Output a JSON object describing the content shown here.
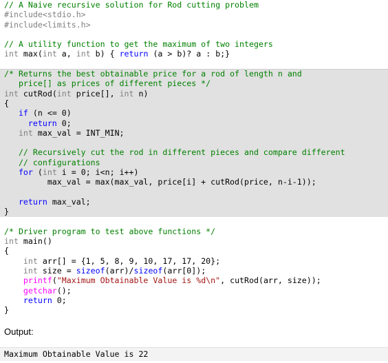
{
  "code": [
    {
      "hl": false,
      "tokens": [
        {
          "t": "// A Naive recursive solution for Rod cutting problem",
          "c": "comment"
        }
      ]
    },
    {
      "hl": false,
      "tokens": [
        {
          "t": "#include<stdio.h>",
          "c": "pre"
        }
      ]
    },
    {
      "hl": false,
      "tokens": [
        {
          "t": "#include<limits.h>",
          "c": "pre"
        }
      ]
    },
    {
      "hl": false,
      "tokens": [
        {
          "t": "",
          "c": "plain"
        }
      ]
    },
    {
      "hl": false,
      "tokens": [
        {
          "t": "// A utility function to get the maximum of two integers",
          "c": "comment"
        }
      ]
    },
    {
      "hl": false,
      "tokens": [
        {
          "t": "int",
          "c": "type"
        },
        {
          "t": " max(",
          "c": "plain"
        },
        {
          "t": "int",
          "c": "type"
        },
        {
          "t": " a, ",
          "c": "plain"
        },
        {
          "t": "int",
          "c": "type"
        },
        {
          "t": " b) { ",
          "c": "plain"
        },
        {
          "t": "return",
          "c": "kw"
        },
        {
          "t": " (a > b)? a : b;}",
          "c": "plain"
        }
      ]
    },
    {
      "hl": false,
      "tokens": [
        {
          "t": "",
          "c": "plain"
        }
      ]
    },
    {
      "hl": true,
      "first": true,
      "tokens": [
        {
          "t": "/* Returns the best obtainable price for a rod of length n and",
          "c": "comment"
        }
      ]
    },
    {
      "hl": true,
      "tokens": [
        {
          "t": "   price[] as prices of different pieces */",
          "c": "comment"
        }
      ]
    },
    {
      "hl": true,
      "tokens": [
        {
          "t": "int",
          "c": "type"
        },
        {
          "t": " cutRod(",
          "c": "plain"
        },
        {
          "t": "int",
          "c": "type"
        },
        {
          "t": " price[], ",
          "c": "plain"
        },
        {
          "t": "int",
          "c": "type"
        },
        {
          "t": " n)",
          "c": "plain"
        }
      ]
    },
    {
      "hl": true,
      "tokens": [
        {
          "t": "{",
          "c": "plain"
        }
      ]
    },
    {
      "hl": true,
      "tokens": [
        {
          "t": "   ",
          "c": "plain"
        },
        {
          "t": "if",
          "c": "kw"
        },
        {
          "t": " (n <= 0)",
          "c": "plain"
        }
      ]
    },
    {
      "hl": true,
      "tokens": [
        {
          "t": "     ",
          "c": "plain"
        },
        {
          "t": "return",
          "c": "kw"
        },
        {
          "t": " 0;",
          "c": "plain"
        }
      ]
    },
    {
      "hl": true,
      "tokens": [
        {
          "t": "   ",
          "c": "plain"
        },
        {
          "t": "int",
          "c": "type"
        },
        {
          "t": " max_val = INT_MIN;",
          "c": "plain"
        }
      ]
    },
    {
      "hl": true,
      "tokens": [
        {
          "t": "",
          "c": "plain"
        }
      ]
    },
    {
      "hl": true,
      "tokens": [
        {
          "t": "   // Recursively cut the rod in different pieces and compare different",
          "c": "comment"
        }
      ]
    },
    {
      "hl": true,
      "tokens": [
        {
          "t": "   // configurations",
          "c": "comment"
        }
      ]
    },
    {
      "hl": true,
      "tokens": [
        {
          "t": "   ",
          "c": "plain"
        },
        {
          "t": "for",
          "c": "kw"
        },
        {
          "t": " (",
          "c": "plain"
        },
        {
          "t": "int",
          "c": "type"
        },
        {
          "t": " i = 0; i<n; i++)",
          "c": "plain"
        }
      ]
    },
    {
      "hl": true,
      "tokens": [
        {
          "t": "         max_val = max(max_val, price[i] + cutRod(price, n-i-1));",
          "c": "plain"
        }
      ]
    },
    {
      "hl": true,
      "tokens": [
        {
          "t": "",
          "c": "plain"
        }
      ]
    },
    {
      "hl": true,
      "tokens": [
        {
          "t": "   ",
          "c": "plain"
        },
        {
          "t": "return",
          "c": "kw"
        },
        {
          "t": " max_val;",
          "c": "plain"
        }
      ]
    },
    {
      "hl": true,
      "tokens": [
        {
          "t": "}",
          "c": "plain"
        }
      ]
    },
    {
      "hl": false,
      "tokens": [
        {
          "t": "",
          "c": "plain"
        }
      ]
    },
    {
      "hl": false,
      "tokens": [
        {
          "t": "/* Driver program to test above functions */",
          "c": "comment"
        }
      ]
    },
    {
      "hl": false,
      "tokens": [
        {
          "t": "int",
          "c": "type"
        },
        {
          "t": " main()",
          "c": "plain"
        }
      ]
    },
    {
      "hl": false,
      "tokens": [
        {
          "t": "{",
          "c": "plain"
        }
      ]
    },
    {
      "hl": false,
      "tokens": [
        {
          "t": "    ",
          "c": "plain"
        },
        {
          "t": "int",
          "c": "type"
        },
        {
          "t": " arr[] = {1, 5, 8, 9, 10, 17, 17, 20};",
          "c": "plain"
        }
      ]
    },
    {
      "hl": false,
      "tokens": [
        {
          "t": "    ",
          "c": "plain"
        },
        {
          "t": "int",
          "c": "type"
        },
        {
          "t": " size = ",
          "c": "plain"
        },
        {
          "t": "sizeof",
          "c": "kw"
        },
        {
          "t": "(arr)/",
          "c": "plain"
        },
        {
          "t": "sizeof",
          "c": "kw"
        },
        {
          "t": "(arr[0]);",
          "c": "plain"
        }
      ]
    },
    {
      "hl": false,
      "tokens": [
        {
          "t": "    ",
          "c": "plain"
        },
        {
          "t": "printf",
          "c": "fn"
        },
        {
          "t": "(",
          "c": "plain"
        },
        {
          "t": "\"Maximum Obtainable Value is %d\\n\"",
          "c": "str"
        },
        {
          "t": ", cutRod(arr, size));",
          "c": "plain"
        }
      ]
    },
    {
      "hl": false,
      "tokens": [
        {
          "t": "    ",
          "c": "plain"
        },
        {
          "t": "getchar",
          "c": "fn"
        },
        {
          "t": "();",
          "c": "plain"
        }
      ]
    },
    {
      "hl": false,
      "tokens": [
        {
          "t": "    ",
          "c": "plain"
        },
        {
          "t": "return",
          "c": "kw"
        },
        {
          "t": " 0;",
          "c": "plain"
        }
      ]
    },
    {
      "hl": false,
      "tokens": [
        {
          "t": "}",
          "c": "plain"
        }
      ]
    }
  ],
  "output": {
    "label": "Output:",
    "text": "Maximum Obtainable Value is 22"
  },
  "colors": {
    "comment": "#008000",
    "keyword": "#0000ff",
    "type": "#808080",
    "string": "#a31515",
    "function": "#ff00ff",
    "highlight_bg": "#e1e1e1"
  }
}
